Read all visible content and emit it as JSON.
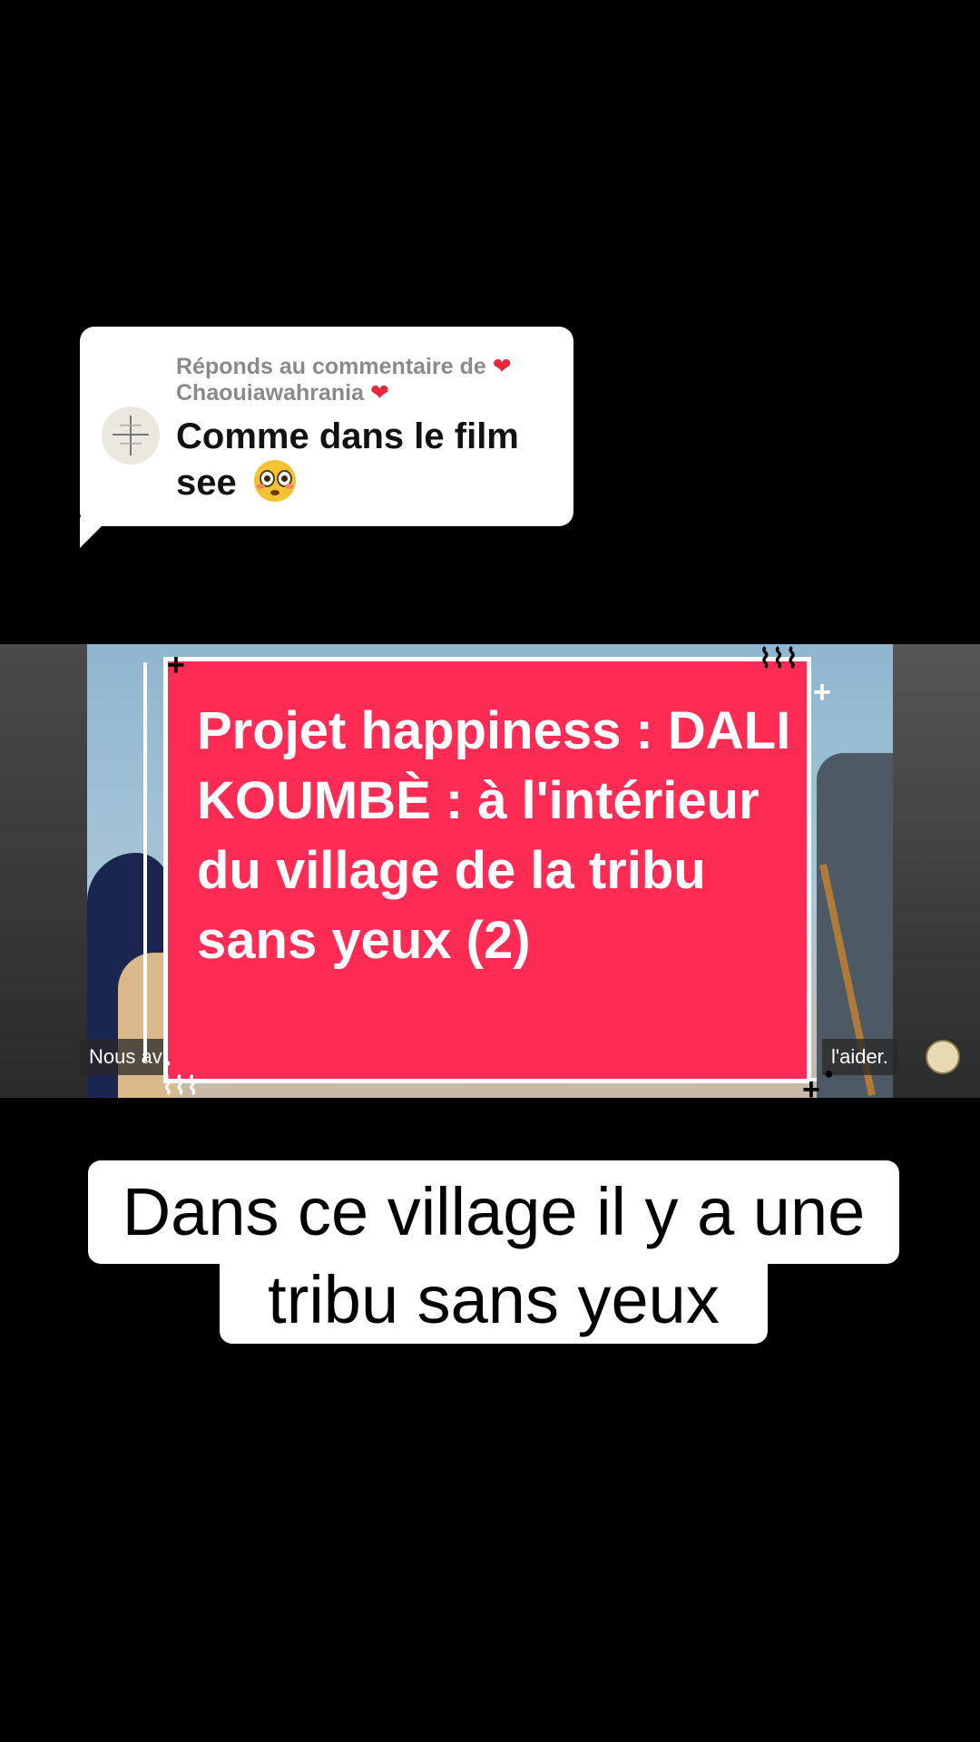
{
  "reply": {
    "label_prefix": "Réponds au commentaire de",
    "username": "Chaouiawahrania",
    "comment_line1": "Comme dans le film",
    "comment_line2": "see"
  },
  "video": {
    "title": "Projet happiness : DALI KOUMBÈ : à l'intérieur du village de la tribu sans yeux (2)",
    "caption_left": "Nous av",
    "caption_right": "l'aider."
  },
  "subtitle": {
    "line1": "Dans ce village il y a une",
    "line2": "tribu sans yeux"
  },
  "colors": {
    "accent": "#fe2c55",
    "heart": "#e8283c"
  },
  "icons": {
    "reply_heart": "broken-heart-icon",
    "comment_emoji": "flushed-face-emoji"
  }
}
